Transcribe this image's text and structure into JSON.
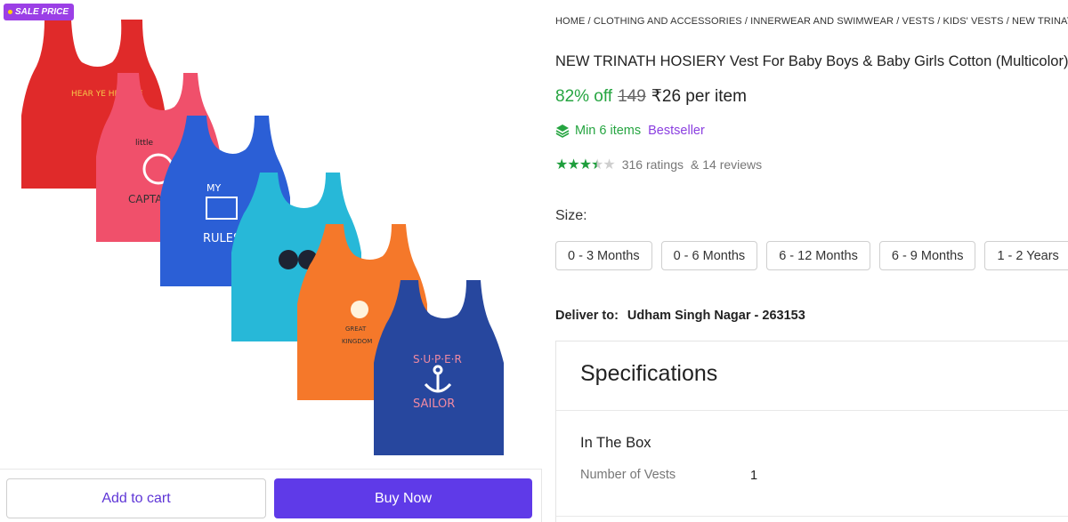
{
  "badge": {
    "text": "SALE PRICE"
  },
  "actions": {
    "add_to_cart": "Add to cart",
    "buy_now": "Buy Now"
  },
  "product": {
    "breadcrumb": "HOME / CLOTHING AND ACCESSORIES / INNERWEAR AND SWIMWEAR / VESTS / KIDS' VESTS / NEW TRINATH HOSIERY",
    "title": "NEW TRINATH HOSIERY Vest For Baby Boys & Baby Girls Cotton (Multicolor)",
    "discount": "82% off",
    "mrp": "149",
    "price": "₹26 per item",
    "min_items": "Min 6 items",
    "bestseller": "Bestseller",
    "rating_value": 3.5,
    "ratings": "316 ratings",
    "reviews": "& 14 reviews"
  },
  "size": {
    "label": "Size:",
    "options": [
      "0 - 3 Months",
      "0 - 6 Months",
      "6 - 12 Months",
      "6 - 9 Months",
      "1 - 2 Years"
    ]
  },
  "delivery": {
    "label": "Deliver to:",
    "location": "Udham Singh Nagar - 263153"
  },
  "specifications": {
    "title": "Specifications",
    "section": "In The Box",
    "rows": [
      {
        "key": "Number of Vests",
        "value": "1"
      }
    ]
  },
  "vest_prints": [
    "HEAR YE HEAR YE",
    "little",
    "CAPTAIN",
    "MY",
    "RULES",
    "GREAT",
    "KINGDOM",
    "S·U·P·E·R",
    "SAILOR"
  ],
  "colors": {
    "accent": "#5f3ae8",
    "green": "#26a541",
    "purple": "#8b3fe0",
    "badge": "#9b3fe6"
  }
}
